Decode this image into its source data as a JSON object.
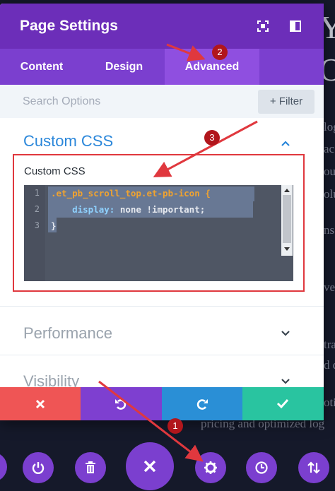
{
  "modal": {
    "title": "Page Settings",
    "tabs": [
      {
        "label": "Content"
      },
      {
        "label": "Design"
      },
      {
        "label": "Advanced"
      }
    ],
    "active_tab": "Advanced",
    "search": {
      "placeholder": "Search Options",
      "value": ""
    },
    "filter_label": "+ Filter",
    "sections": [
      {
        "title": "Custom CSS",
        "expanded": true
      },
      {
        "title": "Performance",
        "expanded": false
      },
      {
        "title": "Visibility",
        "expanded": false
      }
    ],
    "custom_css": {
      "label": "Custom CSS",
      "lines": [
        {
          "num": "1",
          "text": ".et_pb_scroll_top.et-pb-icon {"
        },
        {
          "num": "2",
          "indent": "    ",
          "prop": "display:",
          "value": " none !important;"
        },
        {
          "num": "3",
          "text": "}"
        }
      ]
    }
  },
  "action_bar": [
    {
      "name": "discard",
      "icon": "x-icon",
      "color": "#ef5555"
    },
    {
      "name": "undo",
      "icon": "undo-icon",
      "color": "#7e3fd0"
    },
    {
      "name": "redo",
      "icon": "redo-icon",
      "color": "#2a8fd6"
    },
    {
      "name": "save",
      "icon": "check-icon",
      "color": "#29c4a0"
    }
  ],
  "floating_bar": [
    "power-icon",
    "trash-icon",
    "close-icon",
    "gear-icon",
    "history-icon",
    "sort-icon"
  ],
  "annotations": [
    "1",
    "2",
    "3"
  ],
  "background_page": {
    "heading_fragments": [
      "Y",
      "O"
    ],
    "text_fragments": [
      "log",
      "ac",
      "ou",
      "olu",
      "ns",
      "ve",
      "tra",
      "d d",
      "otiv",
      "pricing and optimized log"
    ]
  },
  "colors": {
    "header": "#6c2eb9",
    "tabs": "#7b3fcf",
    "active_tab": "#8f4fe0",
    "accent_blue": "#2b87da",
    "code_selector": "#f0a330",
    "code_property": "#8fd2ff",
    "code_value": "#e6e9ef",
    "annotation_red": "#e0383e"
  }
}
